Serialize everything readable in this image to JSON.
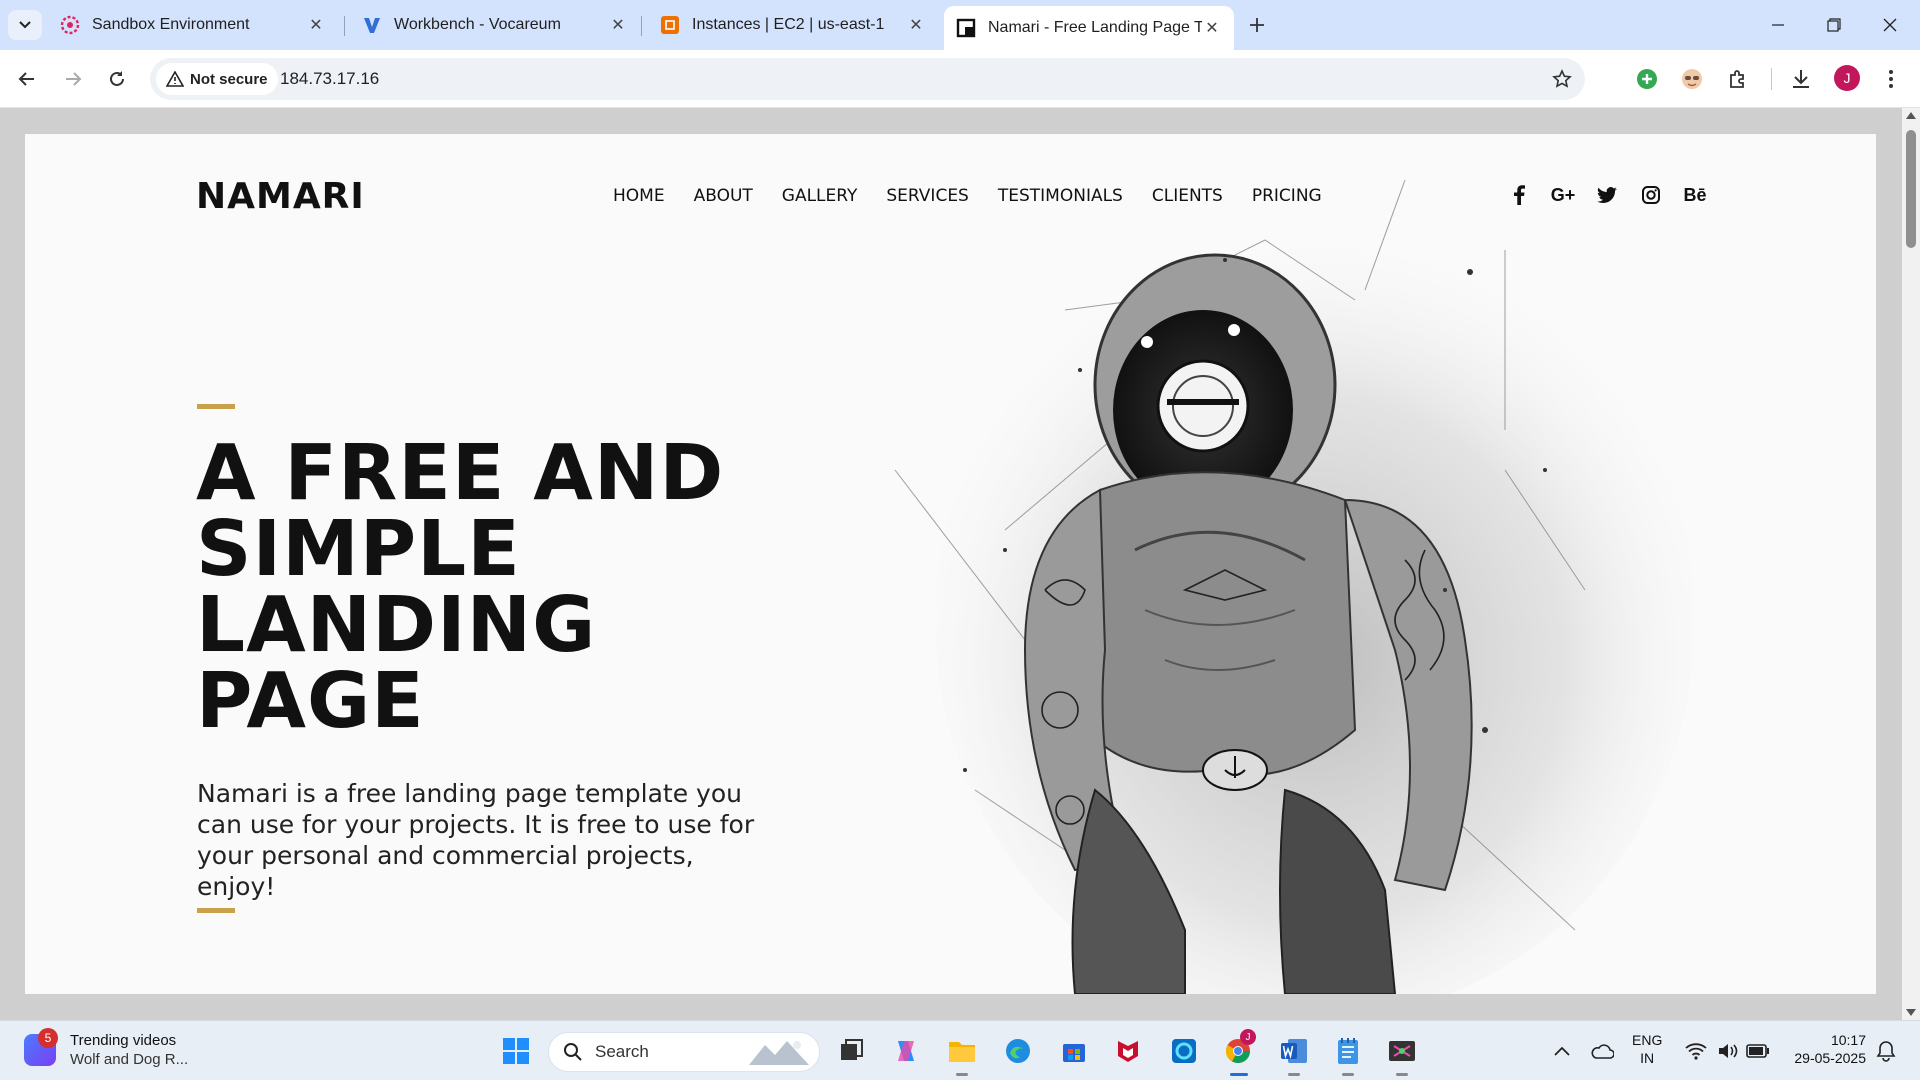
{
  "browser": {
    "tabs": [
      {
        "title": "Sandbox Environment",
        "icon": "sandbox-icon",
        "active": false
      },
      {
        "title": "Workbench - Vocareum",
        "icon": "vocareum-icon",
        "active": false
      },
      {
        "title": "Instances | EC2 | us-east-1",
        "icon": "aws-ec2-icon",
        "active": false
      },
      {
        "title": "Namari - Free Landing Page Ter",
        "icon": "page-icon",
        "active": true
      }
    ],
    "security_label": "Not secure",
    "url": "184.73.17.16",
    "profile_initial": "J"
  },
  "site": {
    "logo": "NAMARI",
    "nav": [
      "HOME",
      "ABOUT",
      "GALLERY",
      "SERVICES",
      "TESTIMONIALS",
      "CLIENTS",
      "PRICING"
    ],
    "social": [
      {
        "icon": "facebook-icon",
        "glyph": "f"
      },
      {
        "icon": "google-plus-icon",
        "glyph": "G+"
      },
      {
        "icon": "twitter-icon",
        "glyph": "🐦"
      },
      {
        "icon": "instagram-icon",
        "glyph": "◎"
      },
      {
        "icon": "behance-icon",
        "glyph": "Bē"
      }
    ],
    "hero_title_lines": [
      "A FREE AND",
      "SIMPLE",
      "LANDING",
      "PAGE"
    ],
    "hero_text": "Namari is a free landing page template you can use for your projects. It is free to use for your personal and commercial projects, enjoy!",
    "accent_color": "#c9a14a"
  },
  "taskbar": {
    "notification_count": "5",
    "trending_title": "Trending videos",
    "trending_sub": "Wolf and Dog R...",
    "search_placeholder": "Search",
    "lang_line1": "ENG",
    "lang_line2": "IN",
    "time": "10:17",
    "date": "29-05-2025",
    "chrome_badge": "J"
  }
}
